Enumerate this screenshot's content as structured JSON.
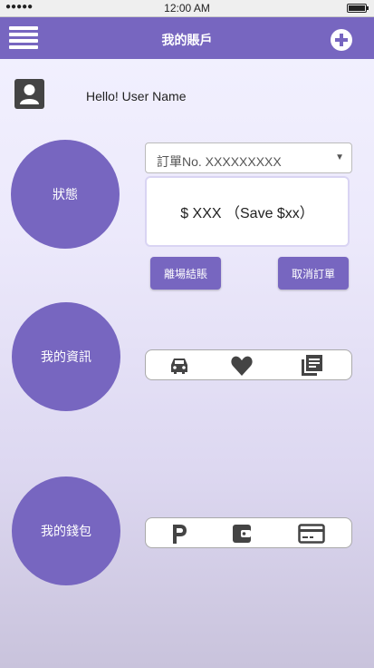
{
  "status_bar": {
    "signal": "●●●●●",
    "time": "12:00 AM"
  },
  "header": {
    "title": "我的賬戶"
  },
  "user": {
    "greeting": "Hello! User Name"
  },
  "sections": {
    "status": {
      "label": "狀態"
    },
    "info": {
      "label": "我的資訊"
    },
    "wallet": {
      "label": "我的錢包"
    }
  },
  "order": {
    "select_value": "訂單No. XXXXXXXXX",
    "price_text": "$ XXX （Save $xx）",
    "checkout_label": "離場結賬",
    "cancel_label": "取消訂單"
  },
  "info_icons": [
    "car-icon",
    "heart-icon",
    "document-icon"
  ],
  "wallet_icons": [
    "parking-icon",
    "wallet-icon",
    "credit-card-icon"
  ],
  "colors": {
    "accent": "#7766c0",
    "icon": "#444444"
  }
}
